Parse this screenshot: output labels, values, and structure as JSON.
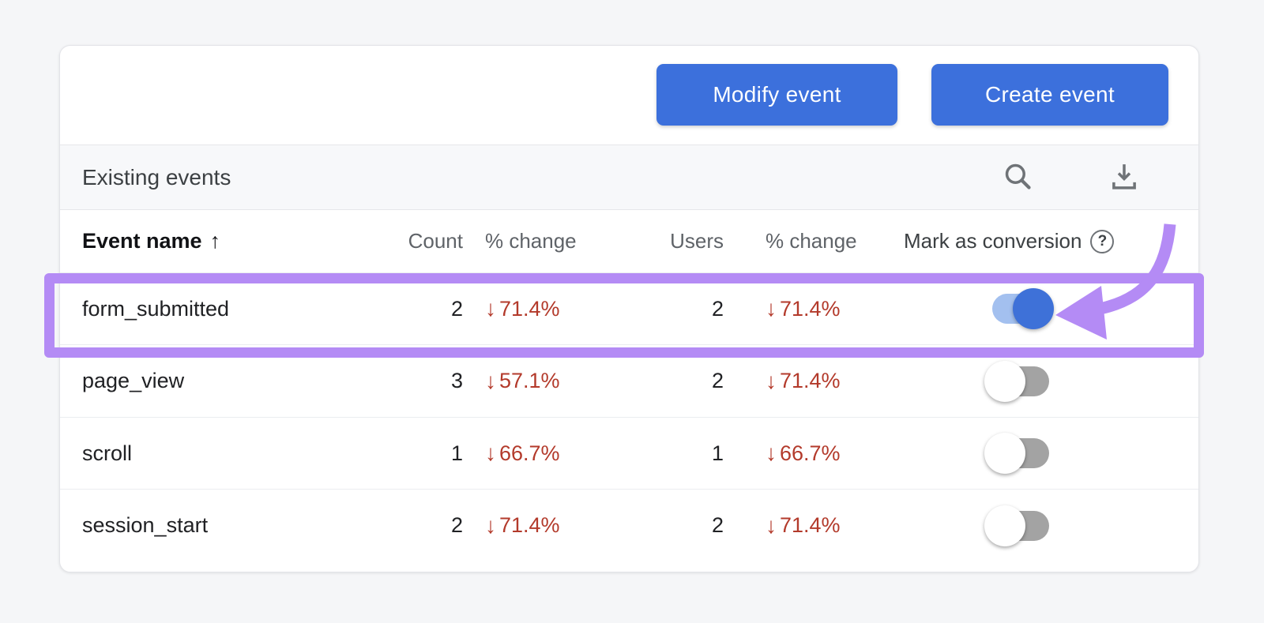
{
  "toolbar": {
    "modify_label": "Modify event",
    "create_label": "Create event"
  },
  "section": {
    "title": "Existing events"
  },
  "table": {
    "headers": {
      "event_name": "Event name",
      "sort_arrow": "↑",
      "count": "Count",
      "count_change": "% change",
      "users": "Users",
      "users_change": "% change",
      "conversion": "Mark as conversion",
      "help": "?"
    },
    "down_arrow": "↓",
    "rows": [
      {
        "name": "form_submitted",
        "count": "2",
        "count_change": "71.4%",
        "users": "2",
        "users_change": "71.4%",
        "conversion_on": true,
        "highlighted": true
      },
      {
        "name": "page_view",
        "count": "3",
        "count_change": "57.1%",
        "users": "2",
        "users_change": "71.4%",
        "conversion_on": false,
        "highlighted": false
      },
      {
        "name": "scroll",
        "count": "1",
        "count_change": "66.7%",
        "users": "1",
        "users_change": "66.7%",
        "conversion_on": false,
        "highlighted": false
      },
      {
        "name": "session_start",
        "count": "2",
        "count_change": "71.4%",
        "users": "2",
        "users_change": "71.4%",
        "conversion_on": false,
        "highlighted": false
      }
    ]
  },
  "colors": {
    "button_blue": "#3c70dc",
    "negative_red": "#b33a2b",
    "annotation_purple": "#b48bf5",
    "toggle_on_track": "#a3c0ef",
    "toggle_on_knob": "#3e71d8"
  }
}
